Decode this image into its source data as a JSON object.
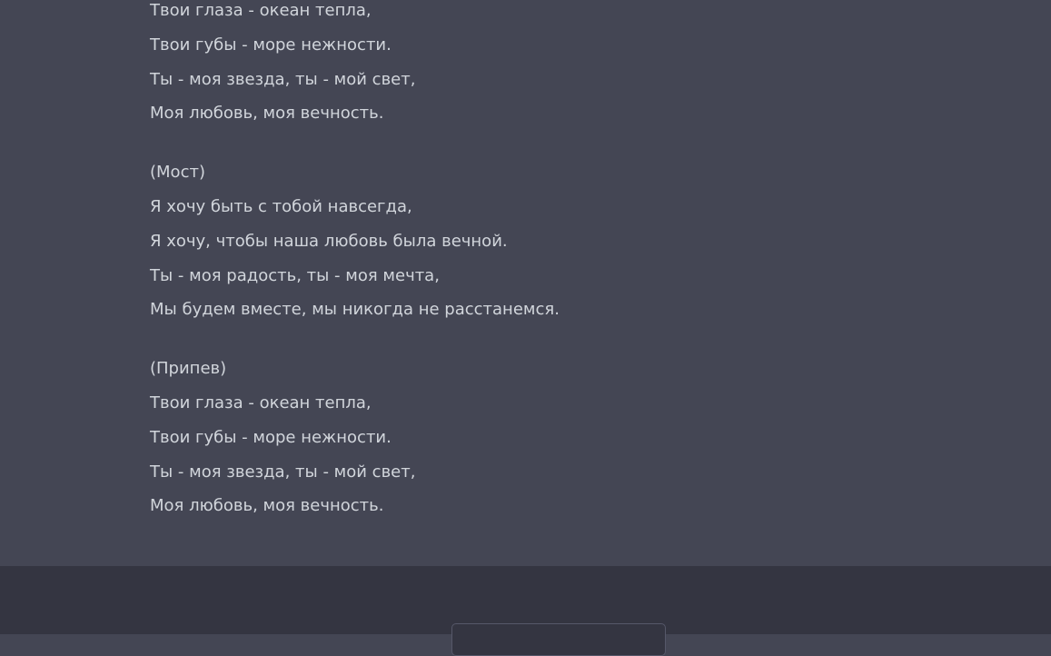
{
  "message": {
    "stanzas": [
      {
        "lines": [
          "Твои глаза - океан тепла,",
          "Твои губы - море нежности.",
          "Ты - моя звезда, ты - мой свет,",
          "Моя любовь, моя вечность."
        ]
      },
      {
        "lines": [
          "(Мост)",
          "Я хочу быть с тобой навсегда,",
          "Я хочу, чтобы наша любовь была вечной.",
          "Ты - моя радость, ты - моя мечта,",
          "Мы будем вместе, мы никогда не расстанемся."
        ]
      },
      {
        "lines": [
          "(Припев)",
          "Твои глаза - океан тепла,",
          "Твои губы - море нежности.",
          "Ты - моя звезда, ты - мой свет,",
          "Моя любовь, моя вечность."
        ]
      }
    ]
  },
  "colors": {
    "message_background": "#444654",
    "page_background": "#343541",
    "text": "#d1d5db",
    "button_border": "#565869"
  }
}
